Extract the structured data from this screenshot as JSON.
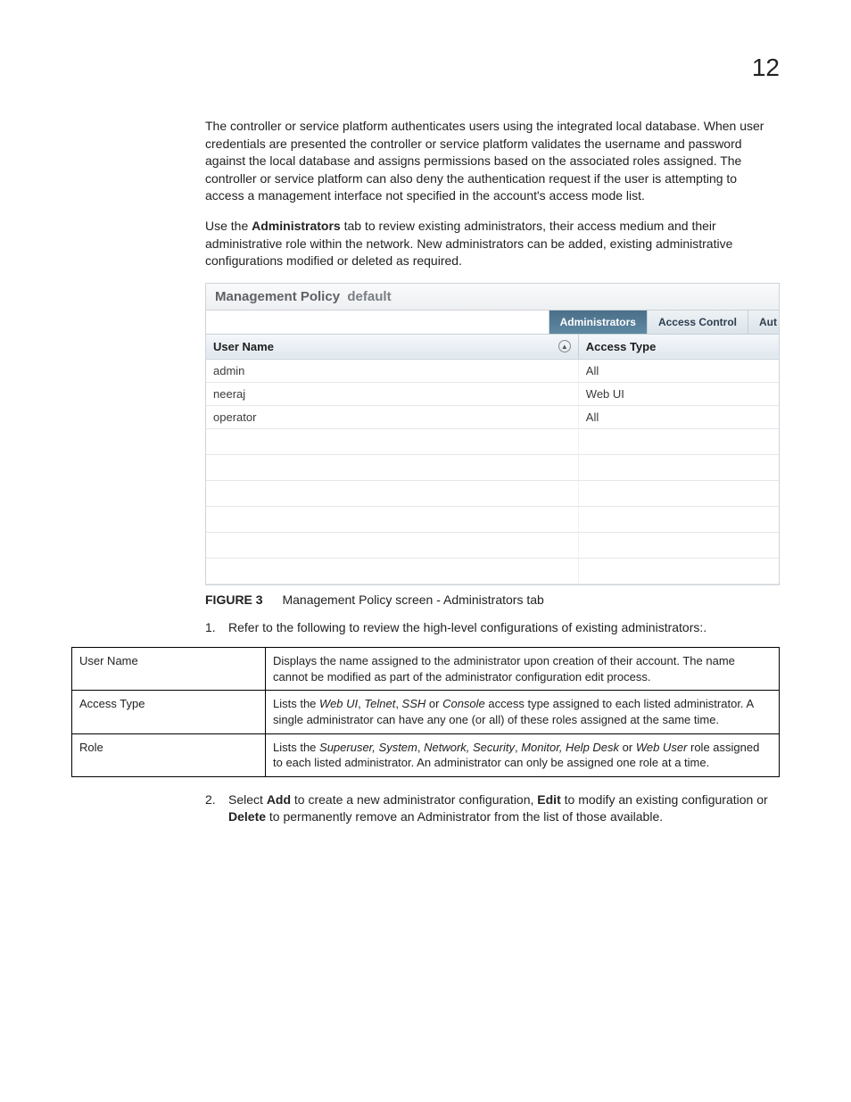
{
  "pageNumber": "12",
  "para1_a": "The controller or service platform authenticates users using the integrated local database. When user credentials are presented the controller or service platform validates the username and password against the local database and assigns permissions based on the associated roles assigned. The controller or service platform can also deny the authentication request if the user is attempting to access a management interface not specified in the account's access mode list.",
  "para2_a": "Use the ",
  "para2_bold": "Administrators",
  "para2_b": " tab to review existing administrators, their access medium and their administrative role within the network. New administrators can be added, existing administrative configurations modified or deleted as required.",
  "figure": {
    "headerStrong": "Management Policy",
    "headerLight": "default",
    "tabs": {
      "active": "Administrators",
      "t2": "Access Control",
      "t3": "Aut"
    },
    "cols": {
      "c1": "User Name",
      "c2": "Access Type"
    },
    "rows": [
      {
        "u": "admin",
        "a": "All"
      },
      {
        "u": "neeraj",
        "a": "Web UI"
      },
      {
        "u": "operator",
        "a": "All"
      }
    ]
  },
  "caption": {
    "label": "FIGURE 3",
    "text": "Management Policy screen - Administrators tab"
  },
  "step1_num": "1.",
  "step1_text": "Refer to the following to review the high-level configurations of existing administrators:.",
  "defs": {
    "r1_term": "User Name",
    "r1_desc": "Displays the name assigned to the administrator upon creation of their account. The name cannot be modified as part of the administrator configuration edit process.",
    "r2_term": "Access Type",
    "r2_desc_a": "Lists the ",
    "r2_desc_i1": "Web UI",
    "r2_desc_b": ", ",
    "r2_desc_i2": "Telnet",
    "r2_desc_c": ", ",
    "r2_desc_i3": "SSH",
    "r2_desc_d": " or ",
    "r2_desc_i4": "Console",
    "r2_desc_e": " access type assigned to each listed administrator. A single administrator can have any one (or all) of these roles assigned at the same time.",
    "r3_term": "Role",
    "r3_desc_a": "Lists the ",
    "r3_desc_i1": "Superuser, System",
    "r3_desc_b": ", ",
    "r3_desc_i2": "Network, Security",
    "r3_desc_c": ", ",
    "r3_desc_i3": "Monitor, Help Desk",
    "r3_desc_d": " or ",
    "r3_desc_i4": "Web User",
    "r3_desc_e": " role assigned to each listed administrator. An administrator can only be assigned one role at a time."
  },
  "step2_num": "2.",
  "step2_a": "Select ",
  "step2_b1": "Add",
  "step2_c": " to create a new administrator configuration, ",
  "step2_b2": "Edit",
  "step2_d": " to modify an existing configuration or ",
  "step2_b3": "Delete",
  "step2_e": " to permanently remove an Administrator from the list of those available."
}
